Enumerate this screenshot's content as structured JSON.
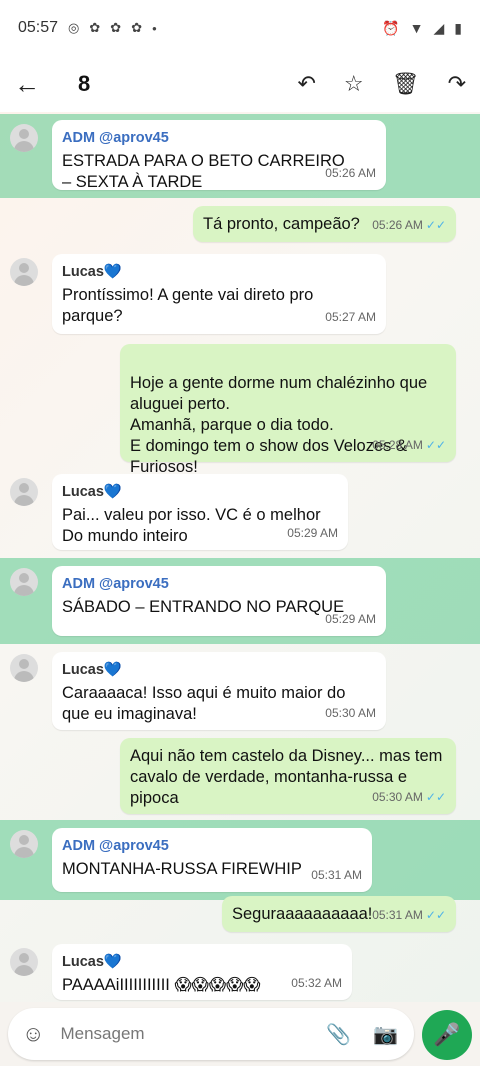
{
  "status": {
    "time": "05:57",
    "icons": [
      "whatsapp-icon",
      "notification-icon",
      "notification-icon",
      "notification-icon",
      "dot-icon"
    ],
    "right_icons": [
      "alarm-icon",
      "wifi-icon",
      "signal-icon",
      "battery-icon"
    ]
  },
  "toolbar": {
    "back_icon": "arrow-left-icon",
    "selected_count": "8",
    "actions": [
      "reply-icon",
      "star-icon",
      "delete-icon",
      "forward-icon"
    ]
  },
  "messages": [
    {
      "id": 1,
      "dir": "in",
      "selected": true,
      "sender": "ADM @aprov45",
      "text": "ESTRADA PARA O BETO CARREIRO – SEXTA À TARDE",
      "time": "05:26 AM"
    },
    {
      "id": 2,
      "dir": "out",
      "selected": false,
      "text": "Tá pronto, campeão?",
      "time": "05:26 AM"
    },
    {
      "id": 3,
      "dir": "in",
      "selected": false,
      "sender": "Lucas💙",
      "text": "Prontíssimo! A gente vai direto pro parque?",
      "time": "05:27 AM"
    },
    {
      "id": 4,
      "dir": "out",
      "selected": false,
      "text": "Hoje a gente dorme num chalézinho que aluguei perto.\nAmanhã, parque o dia todo.\nE domingo tem o show dos Velozes & Furiosos!",
      "time": "05:28 AM"
    },
    {
      "id": 5,
      "dir": "in",
      "selected": false,
      "sender": "Lucas💙",
      "text": "Pai... valeu por isso. VC é o melhor Do mundo inteiro",
      "time": "05:29 AM"
    },
    {
      "id": 6,
      "dir": "in",
      "selected": true,
      "sender": "ADM @aprov45",
      "text": "SÁBADO – ENTRANDO NO PARQUE",
      "time": "05:29 AM"
    },
    {
      "id": 7,
      "dir": "in",
      "selected": false,
      "sender": "Lucas💙",
      "text": "Caraaaaca! Isso aqui é muito maior do que eu imaginava!",
      "time": "05:30 AM"
    },
    {
      "id": 8,
      "dir": "out",
      "selected": false,
      "text": "Aqui não tem castelo da Disney... mas tem cavalo de verdade, montanha-russa e pipoca",
      "time": "05:30 AM"
    },
    {
      "id": 9,
      "dir": "in",
      "selected": true,
      "sender": "ADM @aprov45",
      "text": "MONTANHA-RUSSA FIREWHIP",
      "time": "05:31 AM"
    },
    {
      "id": 10,
      "dir": "out",
      "selected": false,
      "text": "Seguraaaaaaaaaa!",
      "time": "05:31 AM"
    },
    {
      "id": 11,
      "dir": "in",
      "selected": false,
      "sender": "Lucas💙",
      "text": "PAAAAiIIIIIIIIIII 😱😱😱😱😱",
      "time": "05:32 AM"
    }
  ],
  "composer": {
    "placeholder": "Mensagem",
    "emoji_icon": "emoji-icon",
    "attach_icon": "paperclip-icon",
    "camera_icon": "camera-icon",
    "mic_icon": "mic-icon"
  },
  "colors": {
    "selection": "#5ac88c",
    "out_bubble": "#d9f4c4",
    "in_bubble": "#ffffff",
    "accent": "#1fa855",
    "ticks": "#4fb3e8"
  }
}
